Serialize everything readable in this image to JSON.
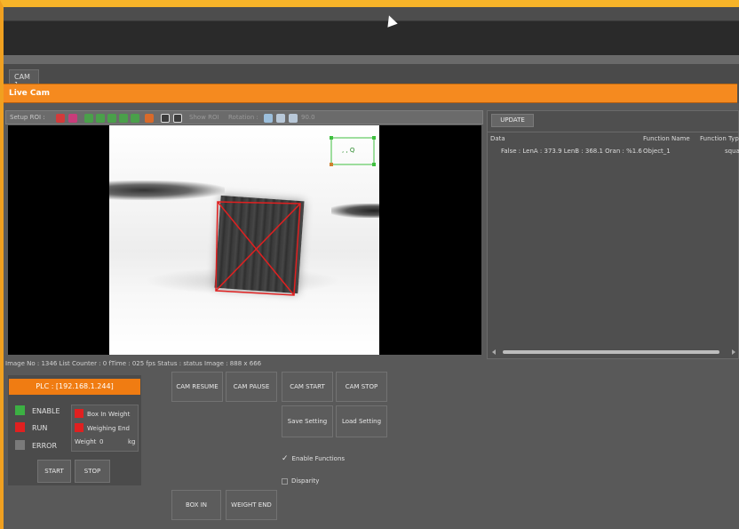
{
  "tab": {
    "label": "CAM 1"
  },
  "live_cam": {
    "title": "Live Cam"
  },
  "toolbar": {
    "setup_roi": "Setup ROI :",
    "show_roi": "Show ROI",
    "rotation_label": "Rotation :",
    "rotation_value": "90.0"
  },
  "roi_overlay": {
    "label": ", , Q"
  },
  "results": {
    "update_button": "UPDATE",
    "columns": [
      "Data",
      "Function Name",
      "Function Type"
    ],
    "rows": [
      {
        "data": "False : LenA : 373.9  LenB : 368.1  Oran : %1.6",
        "name": "Object_1",
        "type": "squar"
      }
    ]
  },
  "status": {
    "text": "Image No : 1346  List Counter : 0  fTime : 025 fps  Status : status  Image : 888 x 666"
  },
  "plc": {
    "address": "PLC : [192.168.1.244]",
    "enable_label": "ENABLE",
    "run_label": "RUN",
    "error_label": "ERROR",
    "box_in_weight_label": "Box In Weight",
    "weighing_end_label": "Weighing End",
    "weight_label": "Weight",
    "weight_value": "0",
    "weight_unit": "kg",
    "start_label": "START",
    "stop_label": "STOP",
    "colors": {
      "enable": "#3cb043",
      "run": "#e02020",
      "error": "#7a7a7a",
      "indicator": "#e02020"
    }
  },
  "controls": {
    "cam_resume": "CAM RESUME",
    "cam_pause": "CAM PAUSE",
    "cam_start": "CAM START",
    "cam_stop": "CAM STOP",
    "save_setting": "Save Setting",
    "load_setting": "Load Setting",
    "enable_functions": "Enable Functions",
    "enable_functions_checked": true,
    "disparity": "Disparity",
    "disparity_checked": false,
    "box_in": "BOX IN",
    "weight_end": "WEIGHT END"
  }
}
